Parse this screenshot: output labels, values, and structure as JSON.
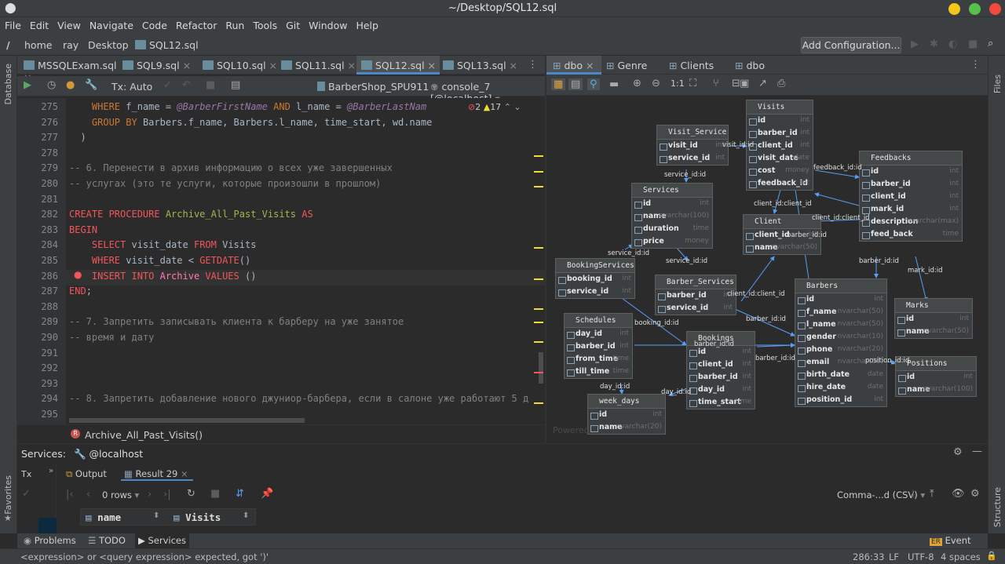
{
  "window": {
    "title": "~/Desktop/SQL12.sql"
  },
  "menu": [
    "File",
    "Edit",
    "View",
    "Navigate",
    "Code",
    "Refactor",
    "Run",
    "Tools",
    "Git",
    "Window",
    "Help"
  ],
  "nav": {
    "crumbs": [
      "home",
      "ray",
      "Desktop",
      "SQL12.sql"
    ],
    "add_config": "Add Configuration..."
  },
  "tabs": [
    "MSSQLExam.sql",
    "SQL9.sql",
    "SQL10.sql",
    "SQL11.sql",
    "SQL12.sql",
    "SQL13.sql"
  ],
  "toolbar": {
    "tx": "Tx: Auto",
    "datasource": "BarberShop_SPU911",
    "console": "console_7 [@localhost]"
  },
  "sidebar": {
    "left_top": "Database",
    "left_bottom": "Favorites",
    "right_top": "Files",
    "right_bottom": "Structure"
  },
  "editor": {
    "errors": "2",
    "warnings": "17",
    "lines": [
      {
        "n": "275",
        "segs": [
          [
            "",
            "    "
          ],
          [
            "kw",
            "WHERE "
          ],
          [
            "",
            "f_name = "
          ],
          [
            "var",
            "@BarberFirstName"
          ],
          [
            "kw",
            " AND "
          ],
          [
            "",
            "l_name = "
          ],
          [
            "var",
            "@BarberLastNam"
          ]
        ]
      },
      {
        "n": "276",
        "segs": [
          [
            "",
            "    "
          ],
          [
            "kw",
            "GROUP BY "
          ],
          [
            "",
            "Barbers.f_name, Barbers.l_name, time_start, wd.name"
          ]
        ]
      },
      {
        "n": "277",
        "segs": [
          [
            "",
            "  )"
          ]
        ]
      },
      {
        "n": "278",
        "segs": []
      },
      {
        "n": "279",
        "segs": [
          [
            "cm",
            "-- 6. Перенести в архив информацию о всех уже завершенных"
          ]
        ]
      },
      {
        "n": "280",
        "segs": [
          [
            "cm",
            "-- услугах (это те услуги, которые произошли в прошлом)"
          ]
        ]
      },
      {
        "n": "281",
        "segs": []
      },
      {
        "n": "282",
        "segs": [
          [
            "kwr",
            "CREATE PROCEDURE "
          ],
          [
            "proc",
            "Archive_All_Past_Visits"
          ],
          [
            "kwr",
            " AS"
          ]
        ]
      },
      {
        "n": "283",
        "segs": [
          [
            "kwr",
            "BEGIN"
          ]
        ]
      },
      {
        "n": "284",
        "segs": [
          [
            "",
            "    "
          ],
          [
            "kwr",
            "SELECT "
          ],
          [
            "",
            "visit_date "
          ],
          [
            "kwr",
            "FROM "
          ],
          [
            "",
            "Visits"
          ]
        ]
      },
      {
        "n": "285",
        "segs": [
          [
            "",
            "    "
          ],
          [
            "kwr",
            "WHERE "
          ],
          [
            "",
            "visit_date < "
          ],
          [
            "kwr",
            "GETDATE"
          ],
          [
            "",
            "()"
          ]
        ]
      },
      {
        "n": "286",
        "segs": [
          [
            "",
            "    "
          ],
          [
            "kwr",
            "INSERT INTO "
          ],
          [
            "pk",
            "Archive "
          ],
          [
            "kwr",
            "VALUES "
          ],
          [
            "",
            "()"
          ]
        ]
      },
      {
        "n": "287",
        "segs": [
          [
            "kwr",
            "END"
          ],
          [
            "",
            ";"
          ]
        ]
      },
      {
        "n": "288",
        "segs": []
      },
      {
        "n": "289",
        "segs": [
          [
            "cm",
            "-- 7. Запретить записывать клиента к барберу на уже занятое"
          ]
        ]
      },
      {
        "n": "290",
        "segs": [
          [
            "cm",
            "-- время и дату"
          ]
        ]
      },
      {
        "n": "291",
        "segs": []
      },
      {
        "n": "292",
        "segs": []
      },
      {
        "n": "293",
        "segs": []
      },
      {
        "n": "294",
        "segs": [
          [
            "cm",
            "-- 8. Запретить добавление нового джуниор-барбера, если в салоне уже работают 5 д"
          ]
        ]
      },
      {
        "n": "295",
        "segs": []
      }
    ],
    "breadcrumb": "Archive_All_Past_Visits()"
  },
  "diagram": {
    "tabs": [
      "dbo",
      "Genre",
      "Clients",
      "dbo"
    ],
    "watermark": "Powered",
    "tables": {
      "Visits": {
        "title": "Visits",
        "rows": [
          [
            "id",
            "int"
          ],
          [
            "barber_id",
            "int"
          ],
          [
            "client_id",
            "int"
          ],
          [
            "visit_date",
            "date"
          ],
          [
            "cost",
            "money"
          ],
          [
            "feedback_id",
            "int"
          ]
        ]
      },
      "Visit_Service": {
        "title": "Visit_Service",
        "rows": [
          [
            "visit_id",
            "int"
          ],
          [
            "service_id",
            "int"
          ]
        ]
      },
      "Feedbacks": {
        "title": "Feedbacks",
        "rows": [
          [
            "id",
            "int"
          ],
          [
            "barber_id",
            "int"
          ],
          [
            "client_id",
            "int"
          ],
          [
            "mark_id",
            "int"
          ],
          [
            "description",
            "nvarchar(max)"
          ],
          [
            "feed_back",
            "time"
          ]
        ]
      },
      "Services": {
        "title": "Services",
        "rows": [
          [
            "id",
            "int"
          ],
          [
            "name",
            "nvarchar(100)"
          ],
          [
            "duration",
            "time"
          ],
          [
            "price",
            "money"
          ]
        ]
      },
      "Client": {
        "title": "Client",
        "rows": [
          [
            "client_id",
            "int"
          ],
          [
            "name",
            "nvarchar(50)"
          ]
        ]
      },
      "BookingServices": {
        "title": "BookingServices",
        "rows": [
          [
            "booking_id",
            "int"
          ],
          [
            "service_id",
            "int"
          ]
        ]
      },
      "Barber_Services": {
        "title": "Barber_Services",
        "rows": [
          [
            "barber_id",
            "int"
          ],
          [
            "service_id",
            "int"
          ]
        ]
      },
      "Barbers": {
        "title": "Barbers",
        "rows": [
          [
            "id",
            "int"
          ],
          [
            "f_name",
            "nvarchar(50)"
          ],
          [
            "l_name",
            "nvarchar(50)"
          ],
          [
            "gender",
            "nvarchar(10)"
          ],
          [
            "phone",
            "nvarchar(20)"
          ],
          [
            "email",
            "nvarchar(50)"
          ],
          [
            "birth_date",
            "date"
          ],
          [
            "hire_date",
            "date"
          ],
          [
            "position_id",
            "int"
          ]
        ]
      },
      "Marks": {
        "title": "Marks",
        "rows": [
          [
            "id",
            "int"
          ],
          [
            "name",
            "nvarchar(50)"
          ]
        ]
      },
      "Schedules": {
        "title": "Schedules",
        "rows": [
          [
            "day_id",
            "int"
          ],
          [
            "barber_id",
            "int"
          ],
          [
            "from_time",
            "time"
          ],
          [
            "till_time",
            "time"
          ]
        ]
      },
      "Bookings": {
        "title": "Bookings",
        "rows": [
          [
            "id",
            "int"
          ],
          [
            "client_id",
            "int"
          ],
          [
            "barber_id",
            "int"
          ],
          [
            "day_id",
            "int"
          ],
          [
            "time_start",
            "time"
          ]
        ]
      },
      "Positions": {
        "title": "Positions",
        "rows": [
          [
            "id",
            "int"
          ],
          [
            "name",
            "nvarchar(100)"
          ]
        ]
      },
      "week_days": {
        "title": "week_days",
        "rows": [
          [
            "id",
            "int"
          ],
          [
            "name",
            "nvarchar(20)"
          ]
        ]
      }
    },
    "relations": [
      "visit_id:id",
      "feedback_id:id",
      "service_id:id",
      "client_id:client_id",
      "client_id:client_id",
      "barber_id:id",
      "service_id:id",
      "service_id:id",
      "barber_id:id",
      "mark_id:id",
      "client_id:client_id",
      "booking_id:id",
      "barber_id:id",
      "barber_id:id",
      "barber_id:id",
      "position_id:id",
      "day_id:id",
      "day_id:id"
    ]
  },
  "services": {
    "label": "Services:",
    "host": "@localhost",
    "tx": "Tx",
    "output": "Output",
    "result": "Result 29",
    "rows": "0 rows",
    "columns": [
      "name",
      "Visits"
    ],
    "export": "Comma-...d (CSV)"
  },
  "bottom_tabs": [
    "Problems",
    "TODO",
    "Services"
  ],
  "event_log": "Event Log",
  "status": {
    "message": "<expression> or <query expression> expected, got ')'",
    "position": "286:33",
    "eol": "LF",
    "encoding": "UTF-8",
    "indent": "4 spaces"
  },
  "colors": {
    "accent": "#4a88c7",
    "keyword": "#cc7832",
    "comment": "#808080",
    "error": "#f2555a",
    "warning": "#f0dd3a"
  }
}
